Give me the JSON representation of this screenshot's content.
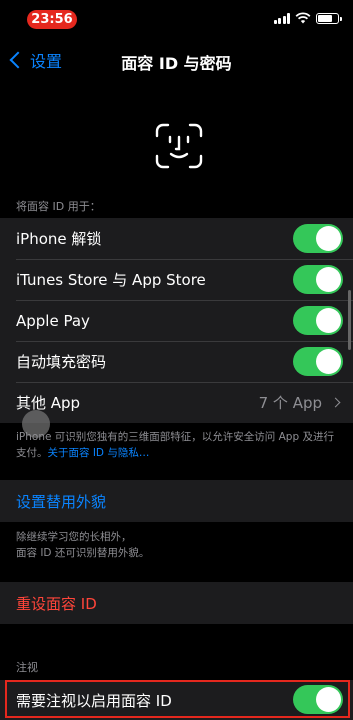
{
  "status": {
    "time": "23:56"
  },
  "nav": {
    "back_label": "设置",
    "title": "面容 ID 与密码"
  },
  "use_section": {
    "header": "将面容 ID 用于：",
    "items": [
      {
        "label": "iPhone 解锁",
        "on": true
      },
      {
        "label": "iTunes Store 与 App Store",
        "on": true
      },
      {
        "label": "Apple Pay",
        "on": true
      },
      {
        "label": "自动填充密码",
        "on": true
      }
    ],
    "other_apps": {
      "label": "其他 App",
      "value": "7 个 App"
    }
  },
  "footnote1": {
    "text": "iPhone 可识别您独有的三维面部特征，以允许安全访问 App 及进行支付。",
    "link": "关于面容 ID 与隐私…"
  },
  "alt_appearance": {
    "label": "设置替用外貌"
  },
  "footnote2": {
    "line1": "除继续学习您的长相外，",
    "line2": "面容 ID 还可识别替用外貌。"
  },
  "reset": {
    "label": "重设面容 ID"
  },
  "attention": {
    "header": "注视",
    "require_label": "需要注视以启用面容 ID",
    "require_on": true
  },
  "colors": {
    "accent": "#0a84ff",
    "toggle_on": "#34c759",
    "destructive": "#ff453a",
    "highlight": "#e5281e"
  }
}
